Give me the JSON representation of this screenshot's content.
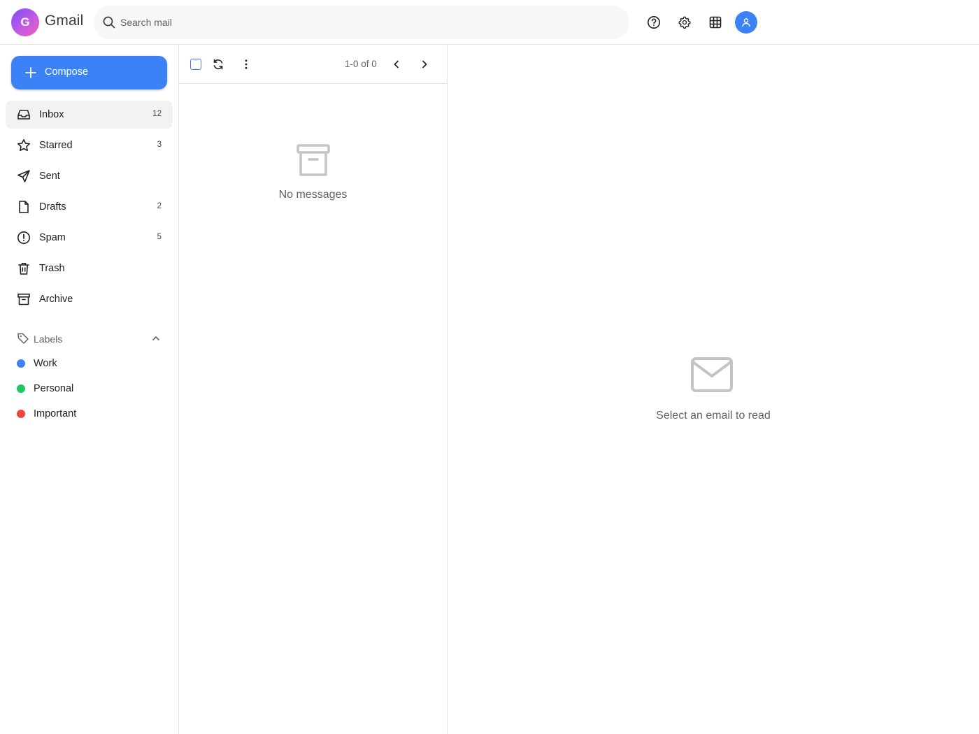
{
  "header": {
    "logo_letter": "G",
    "app_title": "Gmail",
    "search_placeholder": "Search mail",
    "icons": [
      "help-icon",
      "settings-gear-icon",
      "apps-grid-icon",
      "account-avatar-icon"
    ]
  },
  "sidebar": {
    "compose_label": "Compose",
    "folders": [
      {
        "label": "Inbox",
        "count": "12",
        "icon": "inbox-icon",
        "active": true
      },
      {
        "label": "Starred",
        "count": "3",
        "icon": "star-icon"
      },
      {
        "label": "Sent",
        "count": "",
        "icon": "send-icon"
      },
      {
        "label": "Drafts",
        "count": "2",
        "icon": "draft-icon"
      },
      {
        "label": "Spam",
        "count": "5",
        "icon": "spam-icon"
      },
      {
        "label": "Trash",
        "count": "",
        "icon": "trash-icon"
      },
      {
        "label": "Archive",
        "count": "",
        "icon": "archive-icon"
      }
    ],
    "labels_heading": "Labels",
    "labels": [
      {
        "name": "Work",
        "color": "#3b82f6"
      },
      {
        "name": "Personal",
        "color": "#22c55e"
      },
      {
        "name": "Important",
        "color": "#ef4444"
      }
    ]
  },
  "message_list": {
    "page_info": "1-0 of 0",
    "empty_text": "No messages"
  },
  "reading_pane": {
    "empty_text": "Select an email to read"
  },
  "colors": {
    "accent": "#3b82f6",
    "divider": "#e3e3e3",
    "muted_icon": "#c4c4c4"
  }
}
